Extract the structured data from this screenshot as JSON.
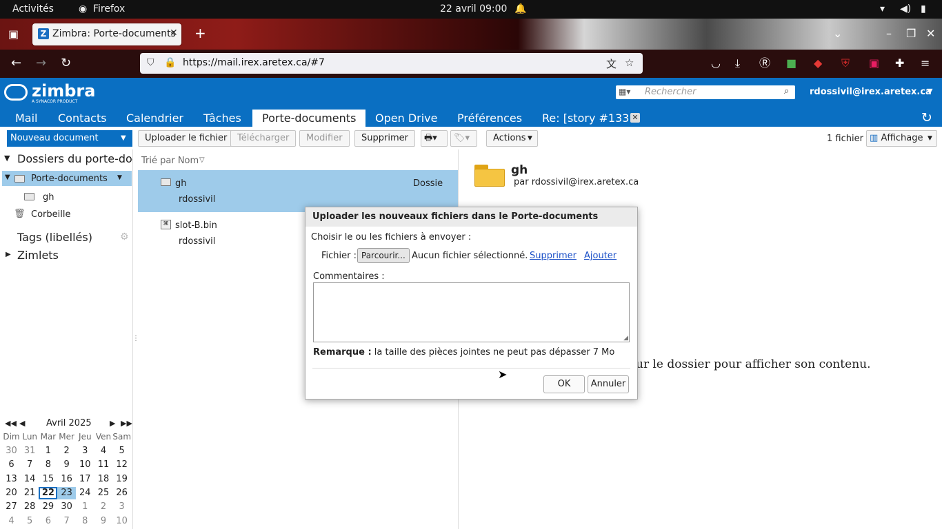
{
  "system": {
    "activities": "Activités",
    "app_name": "Firefox",
    "clock": "22 avril  09:00"
  },
  "browser": {
    "tab_title": "Zimbra: Porte-documents",
    "url": "https://mail.irex.aretex.ca/#7"
  },
  "zimbra": {
    "logo": "zimbra",
    "logo_sub": "A SYNACOR PRODUCT",
    "search_placeholder": "Rechercher",
    "user": "rdossivil@irex.aretex.ca",
    "apps": [
      "Mail",
      "Contacts",
      "Calendrier",
      "Tâches",
      "Porte-documents",
      "Open Drive",
      "Préférences",
      "Re: [story #133"
    ],
    "selected_app": "Porte-documents"
  },
  "toolbar": {
    "new_doc": "Nouveau document",
    "upload": "Uploader le fichier",
    "download": "Télécharger",
    "edit": "Modifier",
    "delete": "Supprimer",
    "actions": "Actions",
    "file_count": "1 fichier",
    "view": "Affichage"
  },
  "sidebar": {
    "folders_header": "Dossiers du porte-doc",
    "root": "Porte-documents",
    "child": "gh",
    "trash": "Corbeille",
    "tags": "Tags (libellés)",
    "zimlets": "Zimlets"
  },
  "list": {
    "sort_label": "Trié par Nom",
    "items": [
      {
        "name": "gh",
        "owner": "rdossivil",
        "type": "Dossie"
      },
      {
        "name": "slot-B.bin",
        "owner": "rdossivil",
        "type": ""
      }
    ]
  },
  "preview": {
    "folder_name": "gh",
    "by": "par rdossivil@irex.aretex.ca",
    "hint": "ur le dossier pour afficher son contenu."
  },
  "calendar": {
    "month": "Avril 2025",
    "weekdays": [
      "Dim",
      "Lun",
      "Mar",
      "Mer",
      "Jeu",
      "Ven",
      "Sam"
    ],
    "weeks": [
      [
        "30",
        "31",
        "1",
        "2",
        "3",
        "4",
        "5"
      ],
      [
        "6",
        "7",
        "8",
        "9",
        "10",
        "11",
        "12"
      ],
      [
        "13",
        "14",
        "15",
        "16",
        "17",
        "18",
        "19"
      ],
      [
        "20",
        "21",
        "22",
        "23",
        "24",
        "25",
        "26"
      ],
      [
        "27",
        "28",
        "29",
        "30",
        "1",
        "2",
        "3"
      ],
      [
        "4",
        "5",
        "6",
        "7",
        "8",
        "9",
        "10"
      ]
    ],
    "today": "22",
    "selected": "23"
  },
  "dialog": {
    "title": "Uploader les nouveaux fichiers dans le Porte-documents",
    "choose_label": "Choisir le ou les fichiers à envoyer :",
    "file_label": "Fichier :",
    "browse": "Parcourir...",
    "no_file": "Aucun fichier sélectionné.",
    "remove": "Supprimer",
    "add": "Ajouter",
    "comments_label": "Commentaires :",
    "note_bold": "Remarque :",
    "note_text": " la taille des pièces jointes ne peut pas dépasser 7 Mo",
    "ok": "OK",
    "cancel": "Annuler"
  },
  "colors": {
    "zimbra_blue": "#0a6fc2",
    "selection": "#9ecbea",
    "link": "#1a4fc7"
  }
}
